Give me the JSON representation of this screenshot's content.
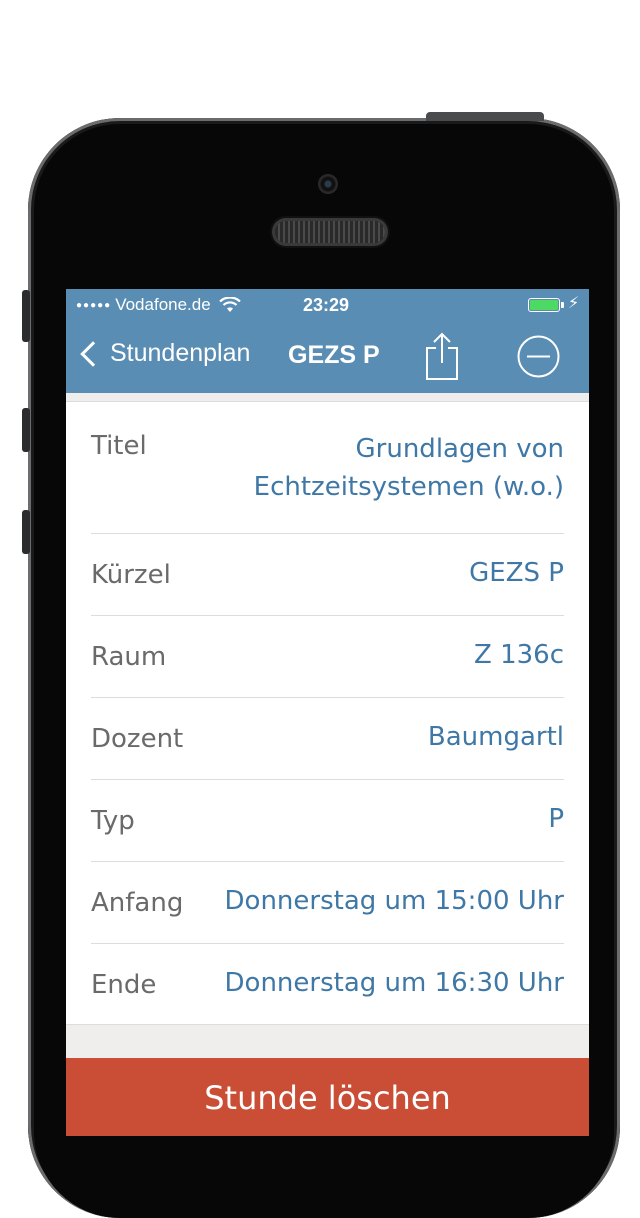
{
  "status_bar": {
    "signal_dots": "●●●●●",
    "carrier": "Vodafone.de",
    "time": "23:29",
    "battery_color": "#4cd964"
  },
  "nav": {
    "back_label": "Stundenplan",
    "title": "GEZS P",
    "share_icon": "share-icon",
    "remove_icon": "minus-circle-icon",
    "bar_color": "#5a8db3"
  },
  "details": [
    {
      "label": "Titel",
      "value": "Grundlagen von Echtzeitsystemen (w.o.)",
      "value_lines": [
        "Grundlagen von",
        "Echtzeitsystemen (w.o.)"
      ]
    },
    {
      "label": "Kürzel",
      "value": "GEZS P"
    },
    {
      "label": "Raum",
      "value": "Z 136c"
    },
    {
      "label": "Dozent",
      "value": "Baumgartl"
    },
    {
      "label": "Typ",
      "value": "P"
    },
    {
      "label": "Anfang",
      "value": "Donnerstag um 15:00 Uhr"
    },
    {
      "label": "Ende",
      "value": "Donnerstag um 16:30 Uhr"
    }
  ],
  "actions": {
    "delete_label": "Stunde löschen",
    "delete_color": "#c94e35"
  }
}
